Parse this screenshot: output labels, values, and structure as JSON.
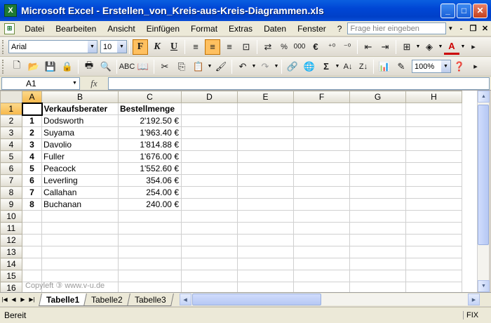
{
  "window": {
    "title": "Microsoft Excel - Erstellen_von_Kreis-aus-Kreis-Diagrammen.xls"
  },
  "menu": {
    "items": [
      {
        "label": "Datei"
      },
      {
        "label": "Bearbeiten"
      },
      {
        "label": "Ansicht"
      },
      {
        "label": "Einfügen"
      },
      {
        "label": "Format"
      },
      {
        "label": "Extras"
      },
      {
        "label": "Daten"
      },
      {
        "label": "Fenster"
      },
      {
        "label": "?"
      }
    ],
    "help_placeholder": "Frage hier eingeben"
  },
  "format_toolbar": {
    "font": "Arial",
    "size": "10",
    "percent": "%",
    "thousands": "000",
    "currency": "€",
    "font_color_letter": "A"
  },
  "standard_toolbar": {
    "zoom": "100%",
    "sigma": "Σ"
  },
  "formula_bar": {
    "name_box": "A1",
    "fx": "fx",
    "content": ""
  },
  "grid": {
    "columns": [
      "A",
      "B",
      "C",
      "D",
      "E",
      "F",
      "G",
      "H"
    ],
    "rows": [
      "1",
      "2",
      "3",
      "4",
      "5",
      "6",
      "7",
      "8",
      "9",
      "10",
      "11",
      "12",
      "13",
      "14",
      "15",
      "16"
    ],
    "header": {
      "b": "Verkaufsberater",
      "c": "Bestellmenge"
    },
    "data": [
      {
        "idx": "1",
        "name": "Dodsworth",
        "value": "2'192.50 €"
      },
      {
        "idx": "2",
        "name": "Suyama",
        "value": "1'963.40 €"
      },
      {
        "idx": "3",
        "name": "Davolio",
        "value": "1'814.88 €"
      },
      {
        "idx": "4",
        "name": "Fuller",
        "value": "1'676.00 €"
      },
      {
        "idx": "5",
        "name": "Peacock",
        "value": "1'552.60 €"
      },
      {
        "idx": "6",
        "name": "Leverling",
        "value": "354.06 €"
      },
      {
        "idx": "7",
        "name": "Callahan",
        "value": "254.00 €"
      },
      {
        "idx": "8",
        "name": "Buchanan",
        "value": "240.00 €"
      }
    ],
    "watermark": "Copyleft ③ www.v-u.de"
  },
  "sheets": [
    {
      "label": "Tabelle1"
    },
    {
      "label": "Tabelle2"
    },
    {
      "label": "Tabelle3"
    }
  ],
  "status": {
    "text": "Bereit",
    "fix": "FIX"
  }
}
